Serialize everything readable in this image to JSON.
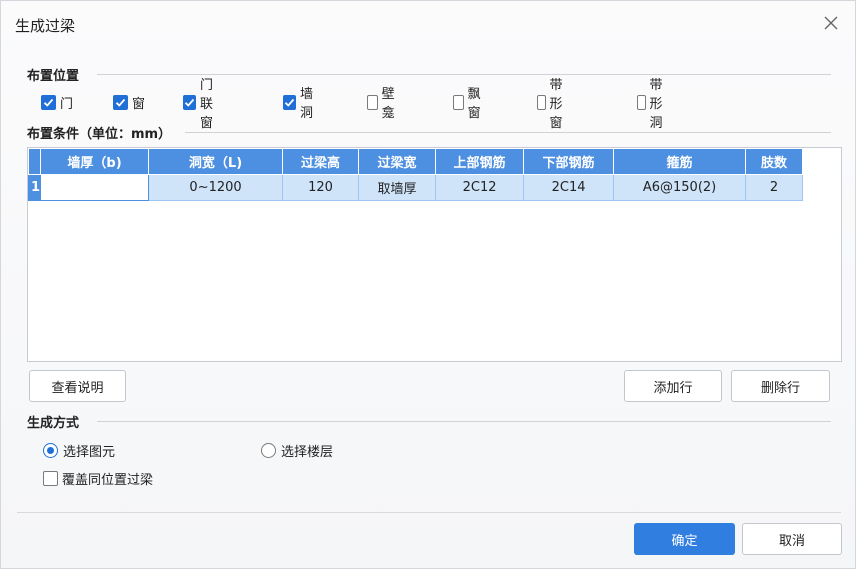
{
  "title": "生成过梁",
  "placement": {
    "label": "布置位置",
    "options": [
      {
        "label": "门",
        "checked": true
      },
      {
        "label": "窗",
        "checked": true
      },
      {
        "label": "门联窗",
        "checked": true
      },
      {
        "label": "墙洞",
        "checked": true
      },
      {
        "label": "壁龛",
        "checked": false
      },
      {
        "label": "飘窗",
        "checked": false
      },
      {
        "label": "带形窗",
        "checked": false
      },
      {
        "label": "带形洞",
        "checked": false
      }
    ]
  },
  "conditions": {
    "label": "布置条件（单位：mm）",
    "columns": [
      "墙厚（b)",
      "洞宽（L)",
      "过梁高",
      "过梁宽",
      "上部钢筋",
      "下部钢筋",
      "箍筋",
      "肢数"
    ],
    "rows": [
      {
        "index": "1",
        "cells": [
          "",
          "0~1200",
          "120",
          "取墙厚",
          "2C12",
          "2C14",
          "A6@150(2)",
          "2"
        ]
      }
    ]
  },
  "buttons": {
    "help": "查看说明",
    "add_row": "添加行",
    "delete_row": "删除行",
    "ok": "确定",
    "cancel": "取消"
  },
  "method": {
    "label": "生成方式",
    "options": [
      {
        "label": "选择图元",
        "selected": true
      },
      {
        "label": "选择楼层",
        "selected": false
      }
    ],
    "overwrite": {
      "label": "覆盖同位置过梁",
      "checked": false
    }
  },
  "colors": {
    "accent": "#2f7ee0",
    "header": "#4d8fe0",
    "row_selected": "#cfe3f9"
  }
}
